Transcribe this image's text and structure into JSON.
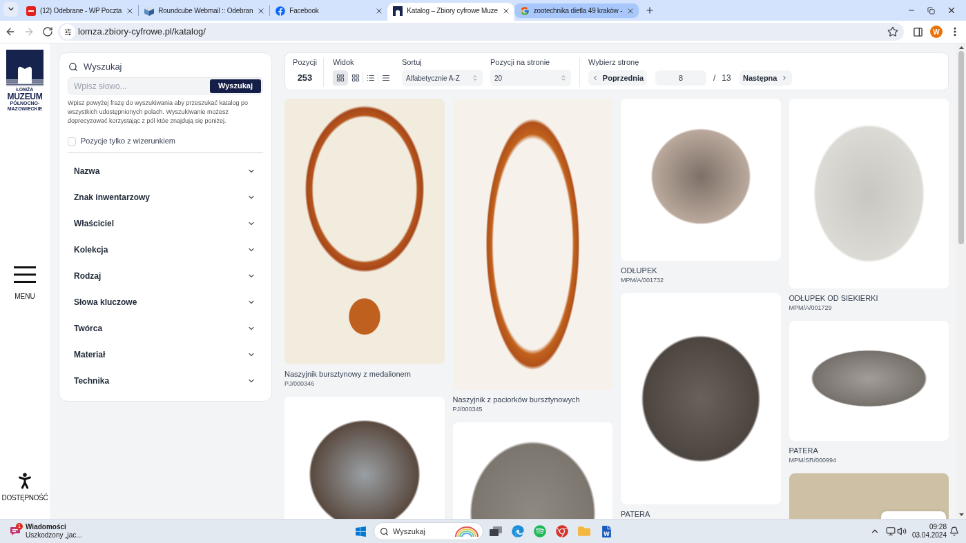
{
  "browser": {
    "tabs": [
      {
        "kind": "wp",
        "title": "(12) Odebrane - WP Poczta",
        "selected": false,
        "highlighted": false
      },
      {
        "kind": "roundcube",
        "title": "Roundcube Webmail :: Odebran",
        "selected": false,
        "highlighted": false
      },
      {
        "kind": "facebook",
        "title": "Facebook",
        "selected": false,
        "highlighted": false
      },
      {
        "kind": "museum",
        "title": "Katalog – Zbiory cyfrowe Muze",
        "selected": true,
        "highlighted": false
      },
      {
        "kind": "google",
        "title": "zootechnika dietla 49 kraków -",
        "selected": false,
        "highlighted": true
      }
    ],
    "nav": [
      {
        "kind": "back",
        "disabled": false
      },
      {
        "kind": "forward",
        "disabled": true
      },
      {
        "kind": "reload",
        "disabled": false
      }
    ],
    "url": "lomza.zbiory-cyfrowe.pl/katalog/",
    "profile_initial": "W"
  },
  "rail": {
    "logo": {
      "city": "ŁOMŻA",
      "name": "MUZEUM",
      "region": "PÓŁNOCNO-MAZOWIECKIE"
    },
    "menu_label": "MENU",
    "accessibility_label": "DOSTĘPNOŚĆ"
  },
  "search": {
    "title": "Wyszukaj",
    "placeholder": "Wpisz słowo...",
    "button": "Wyszukaj",
    "help": "Wpisz powyżej frazę do wyszukiwania aby przeszukać katalog po wszystkich udostępnionych polach. Wyszukiwanie możesz doprecyzować korzystając z pól któe znajdują się poniżej.",
    "image_only": {
      "label": "Pozycje tylko z wizerunkiem",
      "checked": false
    }
  },
  "filters": [
    {
      "label": "Nazwa",
      "expanded": false
    },
    {
      "label": "Znak inwentarzowy",
      "expanded": false
    },
    {
      "label": "Właściciel",
      "expanded": false
    },
    {
      "label": "Kolekcja",
      "expanded": false
    },
    {
      "label": "Rodzaj",
      "expanded": false
    },
    {
      "label": "Słowa kluczowe",
      "expanded": false
    },
    {
      "label": "Twórca",
      "expanded": false
    },
    {
      "label": "Materiał",
      "expanded": false
    },
    {
      "label": "Technika",
      "expanded": false
    }
  ],
  "toolbar": {
    "count_label": "Pozycji",
    "count": "253",
    "view_label": "Widok",
    "views": [
      {
        "kind": "masonry",
        "selected": true
      },
      {
        "kind": "grid",
        "selected": false
      },
      {
        "kind": "list",
        "selected": false
      },
      {
        "kind": "rows",
        "selected": false
      }
    ],
    "sort_label": "Sortuj",
    "sort_value": "Alfabetycznie A-Z",
    "per_page_label": "Pozycji na stronie",
    "per_page_value": "20",
    "page_label": "Wybierz stronę",
    "prev": "Poprzednia",
    "page": "8",
    "separator": "/",
    "total_pages": "13",
    "next": "Następna"
  },
  "results": {
    "columns": [
      {
        "items": [
          {
            "kind": "necklace",
            "title": "Naszyjnik bursztynowy z medalionem",
            "code": "PJ/000346"
          },
          {
            "kind": "flint"
          }
        ]
      },
      {
        "items": [
          {
            "kind": "beads",
            "title": "Naszyjnik z paciorków bursztynowych",
            "code": "PJ/000345"
          },
          {
            "kind": "case"
          }
        ]
      },
      {
        "items": [
          {
            "kind": "flake",
            "title": "ODŁUPEK",
            "code": "MPM/A/001732"
          },
          {
            "kind": "dish",
            "title": "PATERA"
          }
        ]
      },
      {
        "items": [
          {
            "kind": "scraper",
            "title": "ODŁUPEK OD SIEKIERKI",
            "code": "MPM/A/001729"
          },
          {
            "kind": "bowl",
            "title": "PATERA",
            "code": "MPM/SR/000994"
          },
          {
            "kind": "postcard"
          }
        ]
      }
    ]
  },
  "taskbar": {
    "notification": {
      "badge": "1",
      "title": "Wiadomości",
      "text": "Uszkodzony „jac..."
    },
    "search_placeholder": "Wyszukaj",
    "time": "09:28",
    "date": "03.04.2024"
  }
}
